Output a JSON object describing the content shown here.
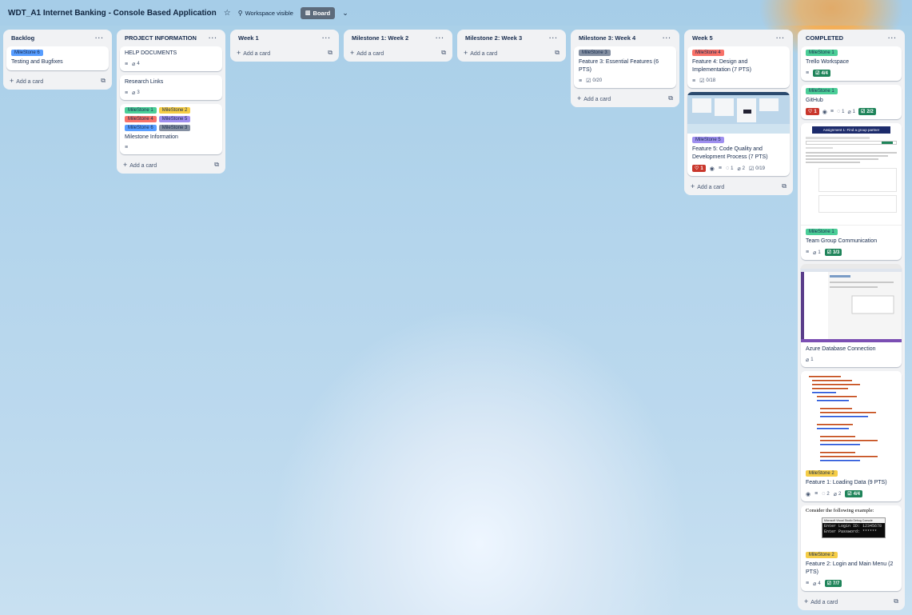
{
  "board": {
    "title": "WDT_A1 Internet Banking - Console Based Application",
    "visibility": "Workspace visible",
    "view_label": "Board"
  },
  "colors": {
    "milestone1": "#4bce97",
    "milestone2": "#f5cd47",
    "milestone3": "#8590a2",
    "milestone4": "#f87168",
    "milestone5": "#9f8fef",
    "milestone6": "#579dff",
    "green_badge": "#1f845a",
    "red_badge": "#c9372c"
  },
  "common": {
    "add_card": "Add a card",
    "list_menu": "···"
  },
  "lists": [
    {
      "title": "Backlog",
      "cards": [
        {
          "labels": [
            "MileStone 6"
          ],
          "title": "Testing and Bugfixes"
        }
      ]
    },
    {
      "title": "PROJECT INFORMATION",
      "cards": [
        {
          "title": "HELP DOCUMENTS",
          "attachments": "4"
        },
        {
          "title": "Research Links",
          "attachments": "3"
        },
        {
          "labels": [
            "MileStone 1",
            "MileStone 2",
            "MileStone 4",
            "MileStone 5",
            "MileStone 6",
            "MileStone 3"
          ],
          "title": "Milestone Information"
        }
      ]
    },
    {
      "title": "Week 1",
      "cards": []
    },
    {
      "title": "Milestone 1: Week 2",
      "cards": []
    },
    {
      "title": "Milestone 2: Week 3",
      "cards": []
    },
    {
      "title": "Milestone 3: Week 4",
      "cards": [
        {
          "labels": [
            "MileStone 3"
          ],
          "title": "Feature 3: Essential Features (6 PTS)",
          "checklist": "0/20"
        }
      ]
    },
    {
      "title": "Week 5",
      "cards": [
        {
          "labels": [
            "MileStone 4"
          ],
          "title": "Feature 4: Design and Implementation (7 PTS)",
          "checklist": "0/18"
        },
        {
          "labels": [
            "MileStone 5"
          ],
          "title": "Feature 5: Code Quality and Development Process (7 PTS)",
          "votes": "1",
          "comments": "1",
          "attachments": "2",
          "checklist": "0/19"
        }
      ]
    },
    {
      "title": "COMPLETED",
      "cards": [
        {
          "labels": [
            "MileStone 1"
          ],
          "title": "Trello Workspace",
          "checklist": "4/4"
        },
        {
          "labels": [
            "MileStone 1"
          ],
          "title": "GitHub",
          "votes": "1",
          "comments": "1",
          "attachments": "1",
          "checklist": "2/2"
        },
        {
          "cover_heading": "Assignment 1: Find a group partner",
          "labels": [
            "MileStone 1"
          ],
          "title": "Team Group Communication",
          "attachments": "1",
          "checklist": "3/3"
        },
        {
          "title": "Azure Database Connection",
          "attachments": "1"
        },
        {
          "labels": [
            "MileStone 2"
          ],
          "title": "Feature 1: Loading Data (9 PTS)",
          "comments": "2",
          "attachments": "2",
          "checklist": "4/4"
        },
        {
          "cover_heading": "Consider the following example:",
          "cover_window": "Microsoft Visual Studio Debug Console",
          "cover_line1": "Enter Login ID: 12345678",
          "cover_line2": "Enter Password: ******",
          "labels": [
            "MileStone 2"
          ],
          "title": "Feature 2: Login and Main Menu (2 PTS)",
          "attachments": "4",
          "checklist": "7/7"
        }
      ]
    }
  ]
}
